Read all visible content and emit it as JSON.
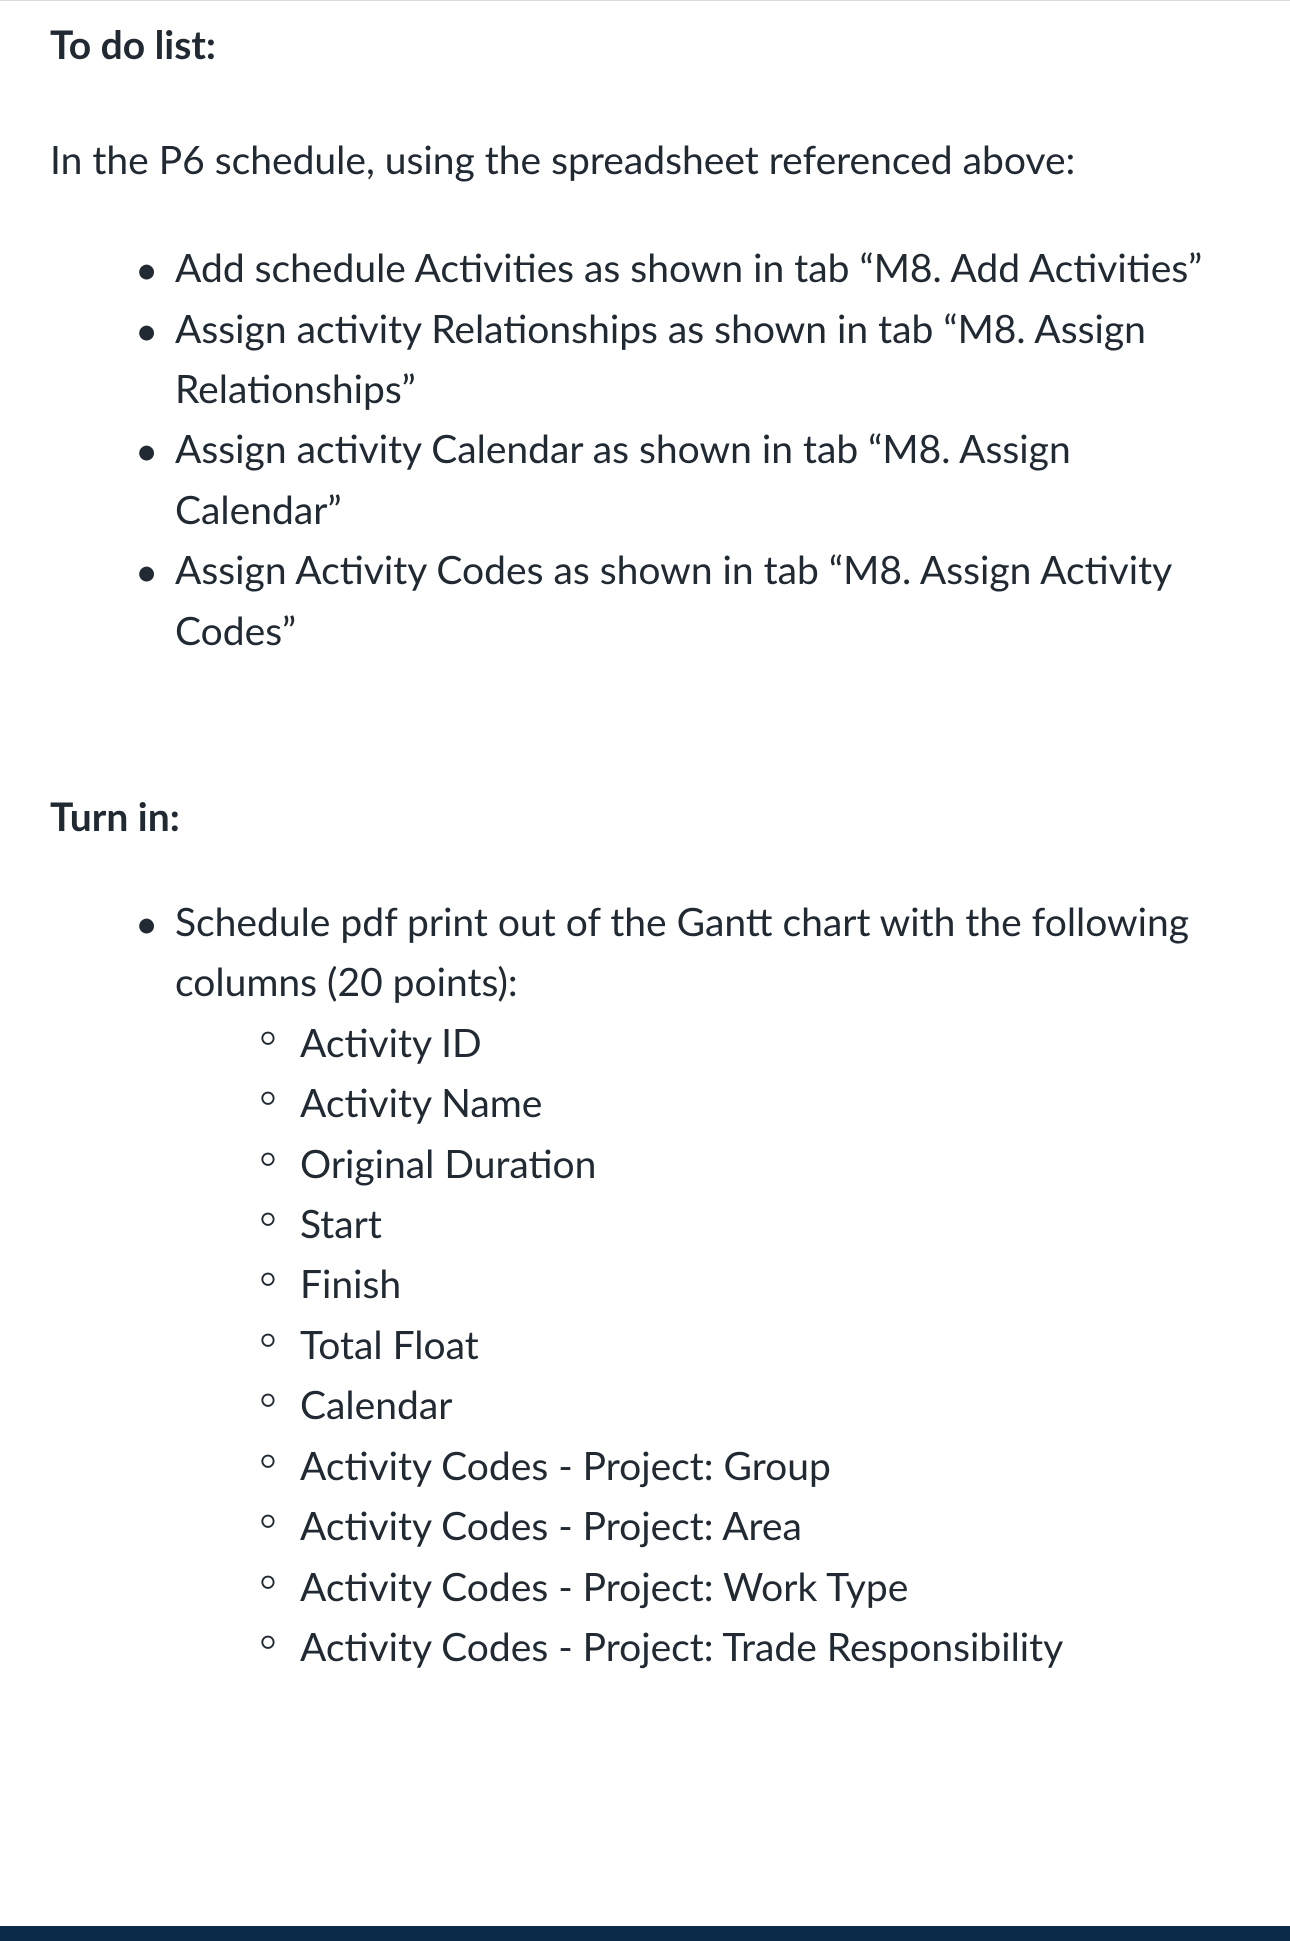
{
  "section1": {
    "heading": "To do list:",
    "intro": "In the P6 schedule, using the spreadsheet referenced above:",
    "items": [
      "Add schedule Activities as shown in tab “M8. Add Activities”",
      "Assign activity Relationships as shown in tab “M8. Assign Relationships”",
      "Assign activity Calendar as shown in tab “M8. Assign Calendar”",
      "Assign Activity Codes as shown in tab “M8. Assign Activity Codes”"
    ]
  },
  "section2": {
    "heading": "Turn in:",
    "items": [
      {
        "text": "Schedule pdf print out of the Gantt chart with the following columns (20 points):",
        "subitems": [
          "Activity ID",
          "Activity Name",
          "Original Duration",
          "Start",
          "Finish",
          "Total Float",
          "Calendar",
          "Activity Codes - Project: Group",
          "Activity Codes - Project: Area",
          "Activity Codes - Project: Work Type",
          "Activity Codes - Project: Trade Responsibility"
        ]
      }
    ]
  }
}
